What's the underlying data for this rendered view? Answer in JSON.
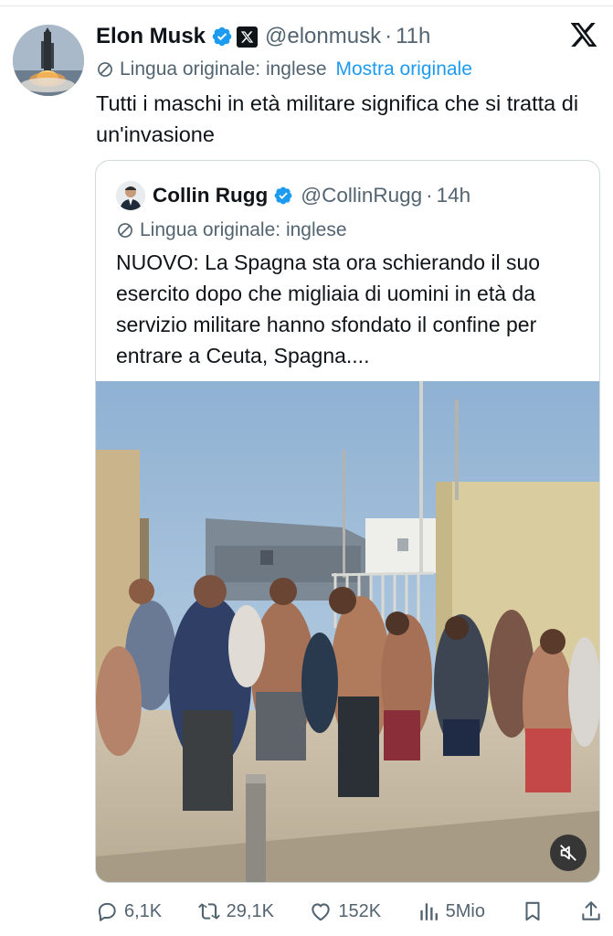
{
  "tweet": {
    "author_name": "Elon Musk",
    "author_handle": "@elonmusk",
    "separator": "·",
    "time": "11h",
    "translation_note": "Lingua originale: inglese",
    "show_original": "Mostra originale",
    "text": "Tutti i maschi in età militare significa che si tratta di un'invasione"
  },
  "quoted_tweet": {
    "author_name": "Collin Rugg",
    "author_handle": "@CollinRugg",
    "separator": "·",
    "time": "14h",
    "translation_note": "Lingua originale: inglese",
    "text": "NUOVO: La Spagna sta ora schierando il suo esercito dopo che migliaia di uomini in età da servizio militare hanno sfondato il confine per entrare a Ceuta, Spagna...."
  },
  "actions": {
    "replies": "6,1K",
    "reposts": "29,1K",
    "likes": "152K",
    "views": "5Mio"
  },
  "icons": [
    "verified-badge-icon",
    "x-logo-icon",
    "translate-icon",
    "mute-icon",
    "reply-icon",
    "repost-icon",
    "like-icon",
    "views-icon",
    "bookmark-icon",
    "share-icon"
  ],
  "colors": {
    "accent": "#1d9bf0",
    "text_primary": "#0f1419",
    "text_secondary": "#536471",
    "border": "#cfd9de"
  }
}
